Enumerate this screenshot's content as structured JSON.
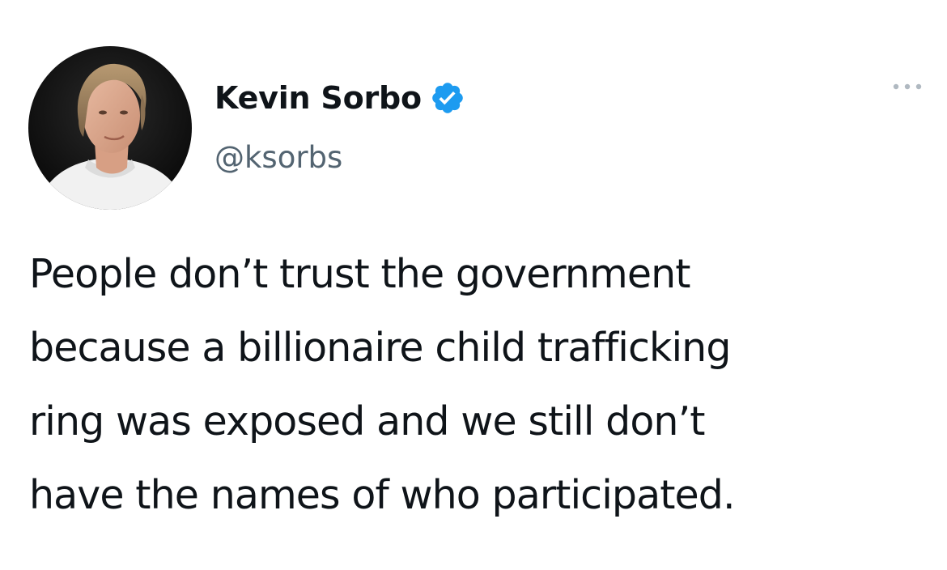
{
  "tweet": {
    "author": {
      "display_name": "Kevin Sorbo",
      "handle": "@ksorbs",
      "verified": true,
      "verified_badge_color": "#1d9bf0"
    },
    "body_lines": [
      "People don’t trust the government",
      "because a billionaire child trafficking",
      "ring was exposed and we still don’t",
      "have the names of who participated."
    ],
    "more_icon": "more-options-icon"
  },
  "colors": {
    "text_primary": "#0f1419",
    "text_secondary": "#536471",
    "accent": "#1d9bf0"
  }
}
